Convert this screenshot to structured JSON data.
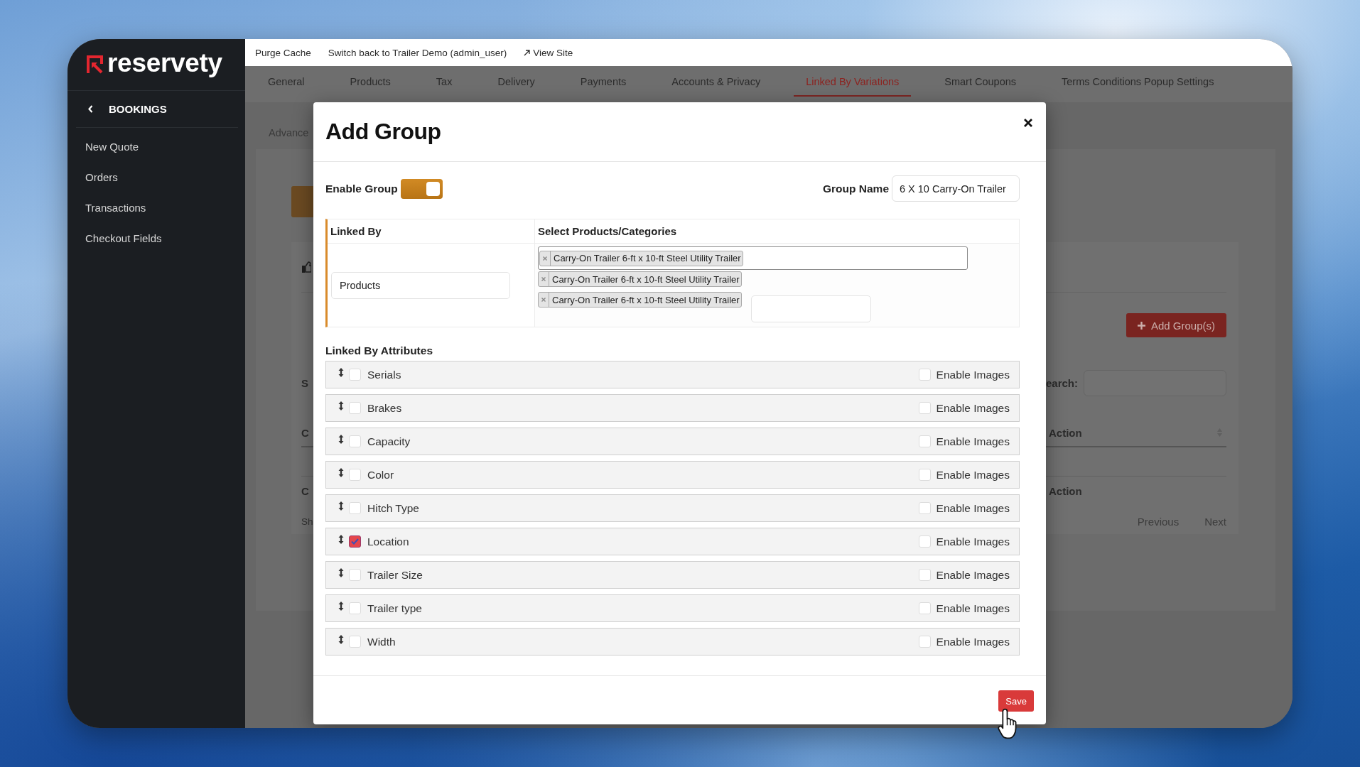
{
  "sidebar": {
    "logo": "reservety",
    "section": "BOOKINGS",
    "items": [
      "New Quote",
      "Orders",
      "Transactions",
      "Checkout Fields"
    ]
  },
  "top_bar": {
    "links": [
      {
        "label": "Purge Cache",
        "external": false
      },
      {
        "label": "Switch back to Trailer Demo (admin_user)",
        "external": false
      },
      {
        "label": "View Site",
        "external": true
      }
    ]
  },
  "tabs": [
    {
      "label": "General",
      "selected": false
    },
    {
      "label": "Products",
      "selected": false
    },
    {
      "label": "Tax",
      "selected": false
    },
    {
      "label": "Delivery",
      "selected": false
    },
    {
      "label": "Payments",
      "selected": false
    },
    {
      "label": "Accounts & Privacy",
      "selected": false
    },
    {
      "label": "Linked By Variations",
      "selected": true
    },
    {
      "label": "Smart Coupons",
      "selected": false
    },
    {
      "label": "Terms Conditions Popup Settings",
      "selected": false
    }
  ],
  "background": {
    "subtab": "Advance",
    "add_button": "Add Group(s)",
    "length_label": "S",
    "search_label": "earch:",
    "table": {
      "header": [
        "C",
        "Action"
      ],
      "footer": [
        "C",
        "Action"
      ]
    },
    "info": "Sh",
    "pagination": [
      "Previous",
      "Next"
    ]
  },
  "modal": {
    "title": "Add Group",
    "enable_group": {
      "label": "Enable Group",
      "on": true
    },
    "group_name": {
      "label": "Group Name",
      "value": "6 X 10 Carry-On Trailer"
    },
    "linked_by": {
      "header": "Linked By",
      "value": "Products"
    },
    "products": {
      "header": "Select Products/Categories",
      "chips": [
        "Carry-On Trailer 6-ft x 10-ft Steel Utility Trailer",
        "Carry-On Trailer 6-ft x 10-ft Steel Utility Trailer",
        "Carry-On Trailer 6-ft x 10-ft Steel Utility Trailer"
      ]
    },
    "attributes": {
      "title": "Linked By Attributes",
      "rows": [
        {
          "name": "Serials",
          "checked": false,
          "images_label": "Enable Images",
          "images_checked": false
        },
        {
          "name": "Brakes",
          "checked": false,
          "images_label": "Enable Images",
          "images_checked": false
        },
        {
          "name": "Capacity",
          "checked": false,
          "images_label": "Enable Images",
          "images_checked": false
        },
        {
          "name": "Color",
          "checked": false,
          "images_label": "Enable Images",
          "images_checked": false
        },
        {
          "name": "Hitch Type",
          "checked": false,
          "images_label": "Enable Images",
          "images_checked": false
        },
        {
          "name": "Location",
          "checked": true,
          "images_label": "Enable Images",
          "images_checked": false
        },
        {
          "name": "Trailer Size",
          "checked": false,
          "images_label": "Enable Images",
          "images_checked": false
        },
        {
          "name": "Trailer type",
          "checked": false,
          "images_label": "Enable Images",
          "images_checked": false
        },
        {
          "name": "Width",
          "checked": false,
          "images_label": "Enable Images",
          "images_checked": false
        }
      ]
    },
    "save": "Save"
  }
}
